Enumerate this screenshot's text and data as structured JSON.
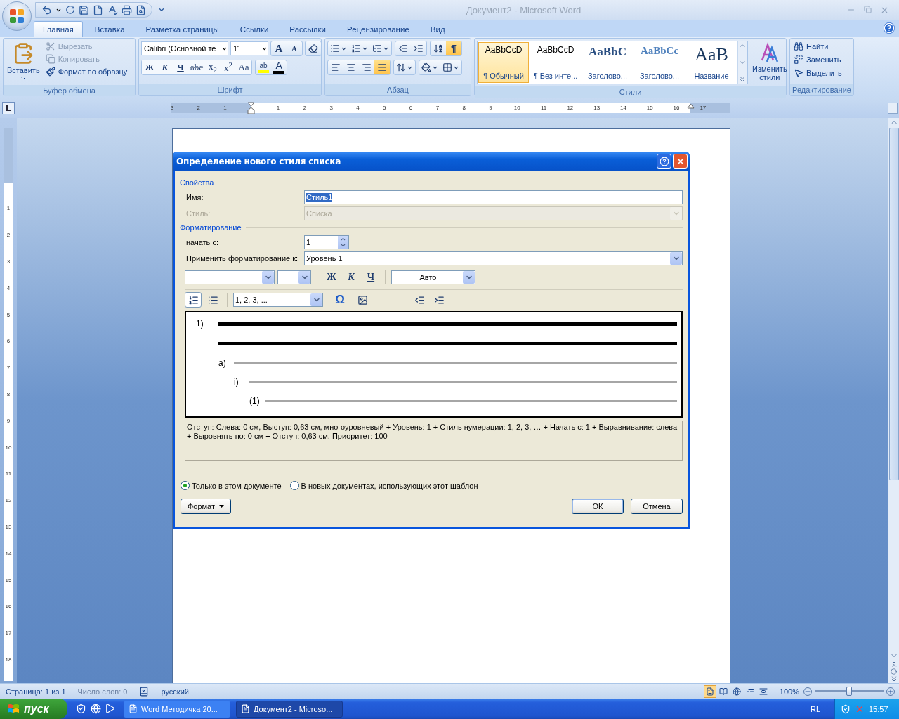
{
  "window": {
    "title": "Документ2 - Microsoft Word"
  },
  "tabs": [
    {
      "label": "Главная",
      "selected": true
    },
    {
      "label": "Вставка",
      "selected": false
    },
    {
      "label": "Разметка страницы",
      "selected": false
    },
    {
      "label": "Ссылки",
      "selected": false
    },
    {
      "label": "Рассылки",
      "selected": false
    },
    {
      "label": "Рецензирование",
      "selected": false
    },
    {
      "label": "Вид",
      "selected": false
    }
  ],
  "clipboard": {
    "title": "Буфер обмена",
    "paste": "Вставить",
    "actions": [
      {
        "label": "Вырезать",
        "disabled": true,
        "kind": "cut"
      },
      {
        "label": "Копировать",
        "disabled": true,
        "kind": "copy"
      },
      {
        "label": "Формат по образцу",
        "disabled": false,
        "kind": "painter"
      }
    ]
  },
  "font": {
    "title": "Шрифт",
    "font_name": "Calibri (Основной те",
    "font_size": "11",
    "grow": "A",
    "shrink": "A",
    "styles": [
      {
        "label": "Ж",
        "kind": "bold"
      },
      {
        "label": "К",
        "kind": "italic"
      },
      {
        "label": "Ч",
        "kind": "underline"
      },
      {
        "label": "abc",
        "kind": "strike"
      },
      {
        "label": "x$_{2}$",
        "kind": "plain"
      },
      {
        "label": "x$^{2}$",
        "kind": "plain"
      },
      {
        "label": "Aa",
        "kind": "plain"
      }
    ],
    "highlight_button": "ab",
    "color_button": "A"
  },
  "paragraph": {
    "title": "Абзац",
    "pilcrow": {
      "label": "¶",
      "selected": true
    },
    "alignments": [
      {
        "kind": "left",
        "selected": false
      },
      {
        "kind": "center",
        "selected": false
      },
      {
        "kind": "right",
        "selected": false
      },
      {
        "kind": "justify",
        "selected": true
      }
    ]
  },
  "styles": {
    "title": "Стили",
    "items": [
      {
        "preview": "AaBbCcD",
        "name": "¶ Обычный",
        "kind": "normal",
        "selected": true
      },
      {
        "preview": "AaBbCcD",
        "name": "¶ Без инте...",
        "kind": "normal",
        "selected": false
      },
      {
        "preview": "AaBbC",
        "name": "Заголово...",
        "kind": "heading1",
        "selected": false
      },
      {
        "preview": "AaBbCc",
        "name": "Заголово...",
        "kind": "heading2",
        "selected": false
      },
      {
        "preview": "AaB",
        "name": "Название",
        "kind": "title",
        "selected": false
      }
    ],
    "change": "Изменить стили"
  },
  "editing": {
    "title": "Редактирование",
    "actions": [
      {
        "label": "Найти",
        "kind": "find"
      },
      {
        "label": "Заменить",
        "kind": "replace"
      },
      {
        "label": "Выделить",
        "kind": "select"
      }
    ]
  },
  "ruler": {
    "left_labels": [
      "3",
      "2",
      "1"
    ],
    "labels": [
      "1",
      "2",
      "3",
      "4",
      "5",
      "6",
      "7",
      "8",
      "9",
      "10",
      "11",
      "12",
      "13",
      "14",
      "15",
      "16",
      "17"
    ]
  },
  "vertical_ruler": {
    "labels": [
      "1",
      "2",
      "3",
      "4",
      "5",
      "6",
      "7",
      "8",
      "9",
      "10",
      "11",
      "12",
      "13",
      "14",
      "15",
      "16",
      "17",
      "18"
    ]
  },
  "dialog": {
    "title": "Определение нового стиля списка",
    "properties": {
      "title": "Свойства",
      "name_label": "Имя:",
      "name_value": "Стиль1",
      "style_label": "Стиль:",
      "style_value": "Списка"
    },
    "formatting": {
      "title": "Форматирование",
      "start_label": "начать с:",
      "start_value": "1",
      "apply_label": "Применить форматирование к:",
      "apply_value": "Уровень 1",
      "bold": "Ж",
      "italic": "К",
      "underline": "Ч",
      "color_value": "Авто",
      "numbered_selected": true,
      "number_style": "1, 2, 3, ...",
      "symbol": "Ω"
    },
    "preview": [
      {
        "marker": "1)",
        "kind": "current",
        "children": [
          {
            "marker": "a)",
            "kind": "other",
            "children": [
              {
                "marker": "i)",
                "kind": "other",
                "children": [
                  {
                    "marker": "(1)",
                    "kind": "other"
                  }
                ]
              }
            ]
          }
        ]
      }
    ],
    "description": "Отступ: Слева:  0 см, Выступ:  0,63 см, многоуровневый + Уровень: 1 + Стиль нумерации: 1, 2, 3, … + Начать с: 1 + Выравнивание: слева + Выровнять по:  0 см + Отступ:  0,63 см, Приоритет: 100",
    "scope": [
      {
        "label": "Только в этом документе",
        "selected": true
      },
      {
        "label": "В новых документах, использующих этот шаблон",
        "selected": false
      }
    ],
    "format_button": "Формат",
    "ok": "ОК",
    "cancel": "Отмена"
  },
  "status_bar": {
    "page": "Страница: 1 из 1",
    "words": "Число слов: 0",
    "language": "русский",
    "views": [
      {
        "selected": true
      },
      {
        "selected": false
      },
      {
        "selected": false
      },
      {
        "selected": false
      },
      {
        "selected": false
      }
    ],
    "zoom": "100%",
    "zoom_slider": {
      "level": 0.5
    }
  },
  "taskbar": {
    "start": "пуск",
    "tasks": [
      {
        "label": "Word Методичка 20...",
        "selected": false
      },
      {
        "label": "Документ2 - Microso...",
        "selected": true
      }
    ],
    "language": "RL",
    "time": "15:57"
  }
}
